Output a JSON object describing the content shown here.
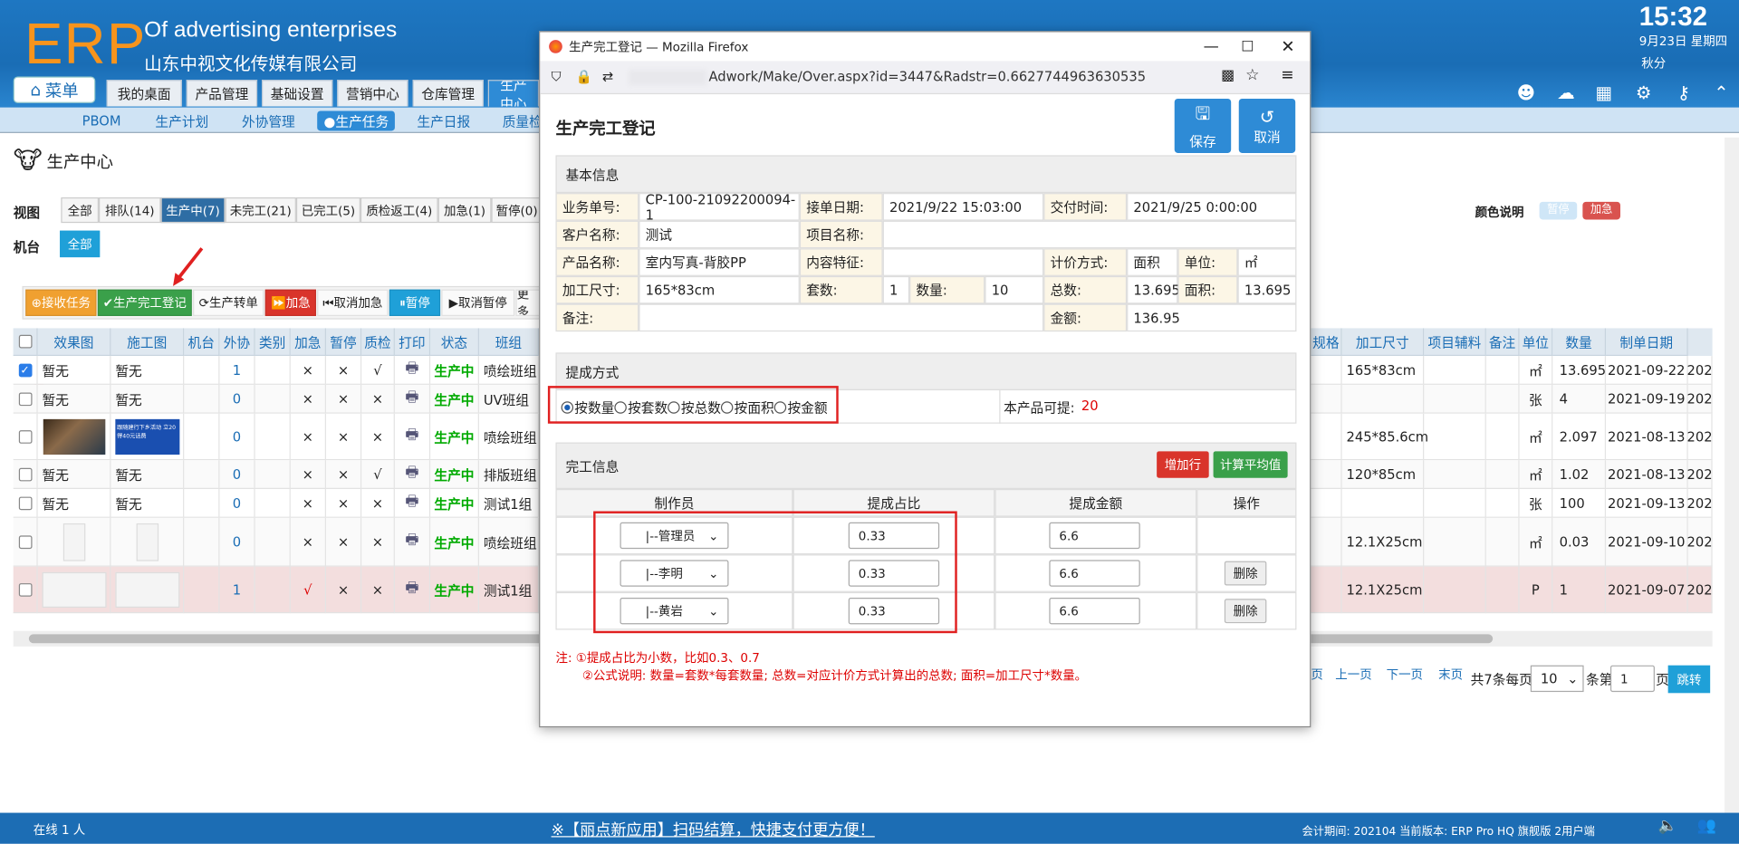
{
  "header": {
    "logo": "ERP",
    "subtitle": "Of advertising enterprises",
    "company": "山东中视文化传媒有限公司",
    "time": "15:32",
    "date": "9月23日 星期四",
    "season": "秋分",
    "menu_label": "菜单",
    "tabs": [
      {
        "label": "我的桌面"
      },
      {
        "label": "产品管理"
      },
      {
        "label": "基础设置"
      },
      {
        "label": "营销中心"
      },
      {
        "label": "仓库管理"
      },
      {
        "label": "生产中心"
      }
    ]
  },
  "subnav": [
    "PBOM",
    "生产计划",
    "外协管理",
    "●生产任务",
    "生产日报",
    "质量检"
  ],
  "page": {
    "title": "生产中心",
    "view_label": "视图",
    "machine_label": "机台",
    "machine_all": "全部",
    "color_legend_label": "颜色说明",
    "legend_pause": "暂停",
    "legend_urgent": "加急",
    "view_tabs": [
      "全部",
      "排队(14)",
      "生产中(7)",
      "未完工(21)",
      "已完工(5)",
      "质检返工(4)",
      "加急(1)",
      "暂停(0)"
    ],
    "actions": [
      "⊕接收任务",
      "✔生产完工登记",
      "⟳生产转单",
      "⏩加急",
      "⏮取消加急",
      "⏸暂停",
      "▶取消暂停",
      "更多"
    ]
  },
  "table": {
    "left_headers": [
      "效果图",
      "施工图",
      "机台",
      "外协",
      "类别",
      "加急",
      "暂停",
      "质检",
      "打印",
      "状态",
      "班组"
    ],
    "right_headers": [
      "规格",
      "加工尺寸",
      "项目辅料",
      "备注",
      "单位",
      "数量",
      "制单日期"
    ],
    "rows": [
      {
        "eff": "暂无",
        "con": "暂无",
        "wx": "1",
        "ji": "×",
        "zt": "×",
        "zj": "√",
        "status": "生产中",
        "team": "喷绘班组",
        "size": "165*83cm",
        "unit": "㎡",
        "qty": "13.695",
        "date": "2021-09-22",
        "yr": "202"
      },
      {
        "eff": "暂无",
        "con": "暂无",
        "wx": "0",
        "ji": "×",
        "zt": "×",
        "zj": "×",
        "status": "生产中",
        "team": "UV班组",
        "size": "",
        "unit": "张",
        "qty": "4",
        "date": "2021-09-19",
        "yr": "202"
      },
      {
        "eff": "",
        "con": "跟随建行下乡活动 立20得40元话费",
        "wx": "0",
        "ji": "×",
        "zt": "×",
        "zj": "×",
        "status": "生产中",
        "team": "喷绘班组",
        "size": "245*85.6cm",
        "unit": "㎡",
        "qty": "2.097",
        "date": "2021-08-13",
        "yr": "202"
      },
      {
        "eff": "暂无",
        "con": "暂无",
        "wx": "0",
        "ji": "×",
        "zt": "×",
        "zj": "√",
        "status": "生产中",
        "team": "排版班组",
        "size": "120*85cm",
        "unit": "㎡",
        "qty": "1.02",
        "date": "2021-08-13",
        "yr": "202"
      },
      {
        "eff": "暂无",
        "con": "暂无",
        "wx": "0",
        "ji": "×",
        "zt": "×",
        "zj": "×",
        "status": "生产中",
        "team": "测试1组",
        "size": "",
        "unit": "张",
        "qty": "100",
        "date": "2021-09-13",
        "yr": "202"
      },
      {
        "eff": "",
        "con": "",
        "wx": "0",
        "ji": "×",
        "zt": "×",
        "zj": "×",
        "status": "生产中",
        "team": "喷绘班组",
        "size": "12.1X25cm",
        "unit": "㎡",
        "qty": "0.03",
        "date": "2021-09-10",
        "yr": "202"
      },
      {
        "eff": "",
        "con": "",
        "wx": "1",
        "ji": "√",
        "zt": "×",
        "zj": "×",
        "status": "生产中",
        "team": "测试1组",
        "size": "12.1X25cm",
        "unit": "P",
        "qty": "1",
        "date": "2021-09-07",
        "yr": "202"
      }
    ]
  },
  "pagination": {
    "prev": "上一页",
    "next": "下一页",
    "last": "末页",
    "total": "共7条每页",
    "per_page": "10",
    "per_unit": "条第",
    "page": "1",
    "page_unit": "页",
    "go": "跳转",
    "first_frag": "页"
  },
  "footer": {
    "online": "在线  1  人",
    "marquee": "※【丽点新应用】扫码结算，快捷支付更方便！",
    "info": "会计期间: 202104 当前版本: ERP Pro HQ 旗舰版 2用户端"
  },
  "modal": {
    "window_title": "生产完工登记 — Mozilla Firefox",
    "url": "Adwork/Make/Over.aspx?id=3447&Radstr=0.6627744963630535",
    "title": "生产完工登记",
    "save": "保存",
    "cancel": "取消",
    "basic": {
      "heading": "基本信息",
      "order_no_lbl": "业务单号:",
      "order_no": "CP-100-21092200094-1",
      "recv_date_lbl": "接单日期:",
      "recv_date": "2021/9/22 15:03:00",
      "deliver_lbl": "交付时间:",
      "deliver": "2021/9/25 0:00:00",
      "customer_lbl": "客户名称:",
      "customer": "测试",
      "project_lbl": "项目名称:",
      "project": "",
      "product_lbl": "产品名称:",
      "product": "室内写真-背胶PP",
      "feature_lbl": "内容特征:",
      "feature": "",
      "price_mode_lbl": "计价方式:",
      "price_mode": "面积",
      "unit_lbl": "单位:",
      "unit": "㎡",
      "size_lbl": "加工尺寸:",
      "size": "165*83cm",
      "sets_lbl": "套数:",
      "sets": "1",
      "qty_lbl": "数量:",
      "qty": "10",
      "total_lbl": "总数:",
      "total": "13.695",
      "area_lbl": "面积:",
      "area": "13.695",
      "remark_lbl": "备注:",
      "amount_lbl": "金额:",
      "amount": "136.95"
    },
    "commission": {
      "heading": "提成方式",
      "options": [
        "按数量",
        "按套数",
        "按总数",
        "按面积",
        "按金额"
      ],
      "available_lbl": "本产品可提:",
      "available": "20"
    },
    "completion": {
      "heading": "完工信息",
      "add_row": "增加行",
      "calc_avg": "计算平均值",
      "headers": [
        "制作员",
        "提成占比",
        "提成金额",
        "操作"
      ],
      "rows": [
        {
          "worker": "|--管理员",
          "ratio": "0.33",
          "amount": "6.6",
          "op": ""
        },
        {
          "worker": "|--李明",
          "ratio": "0.33",
          "amount": "6.6",
          "op": "删除"
        },
        {
          "worker": "|--黄岩",
          "ratio": "0.33",
          "amount": "6.6",
          "op": "删除"
        }
      ]
    },
    "notes": [
      "注: ①提成占比为小数，比如0.3、0.7",
      "②公式说明: 数量=套数*每套数量; 总数=对应计价方式计算出的总数; 面积=加工尺寸*数量。"
    ]
  },
  "colors": {
    "accent": "#1a6db5",
    "header_bg": "#1e77c2",
    "logo": "#f7941d",
    "status_green": "#00aa00",
    "urgent_red": "#e02020"
  }
}
